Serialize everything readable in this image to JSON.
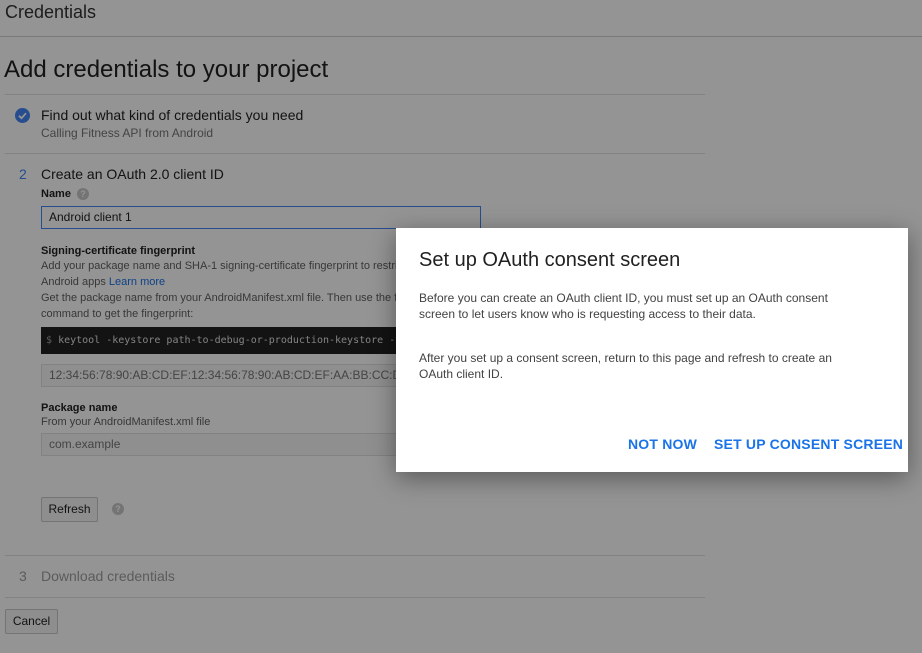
{
  "topbar": {
    "title": "Credentials"
  },
  "page": {
    "heading": "Add credentials to your project"
  },
  "steps": [
    {
      "number": "",
      "title": "Find out what kind of credentials you need",
      "subtitle": "Calling Fitness API from Android"
    },
    {
      "number": "2",
      "title": "Create an OAuth 2.0 client ID"
    },
    {
      "number": "3",
      "title": "Download credentials"
    }
  ],
  "form": {
    "name_label": "Name",
    "name_value": "Android client 1",
    "fingerprint_label": "Signing-certificate fingerprint",
    "fingerprint_desc_line1": "Add your package name and SHA-1 signing-certificate fingerprint to restri",
    "fingerprint_desc_line2_prefix": "Android apps ",
    "learn_more": "Learn more",
    "fingerprint_desc_line3": "Get the package name from your AndroidManifest.xml file. Then use the f",
    "fingerprint_desc_line4": "command to get the fingerprint:",
    "code_prompt": "$",
    "code_command": "keytool -keystore path-to-debug-or-production-keystore -",
    "fingerprint_placeholder": "12:34:56:78:90:AB:CD:EF:12:34:56:78:90:AB:CD:EF:AA:BB:CC:DD",
    "package_label": "Package name",
    "package_desc": "From your AndroidManifest.xml file",
    "package_placeholder": "com.example",
    "refresh_button": "Refresh",
    "help_glyph": "?"
  },
  "footer": {
    "cancel_button": "Cancel"
  },
  "dialog": {
    "title": "Set up OAuth consent screen",
    "para1_line1": "Before you can create an OAuth client ID, you must set up an OAuth consent",
    "para1_line2": "screen to let users know who is requesting access to their data.",
    "para2_line1": "After you set up a consent screen, return to this page and refresh to create an",
    "para2_line2": "OAuth client ID.",
    "not_now": "NOT NOW",
    "set_up": "SET UP CONSENT SCREEN"
  },
  "colors": {
    "accent": "#4285f4",
    "link": "#1a73e8",
    "overlay": "rgba(0,0,0,0.42)"
  },
  "icons": {
    "check": "check-circle-icon",
    "help": "help-icon"
  }
}
